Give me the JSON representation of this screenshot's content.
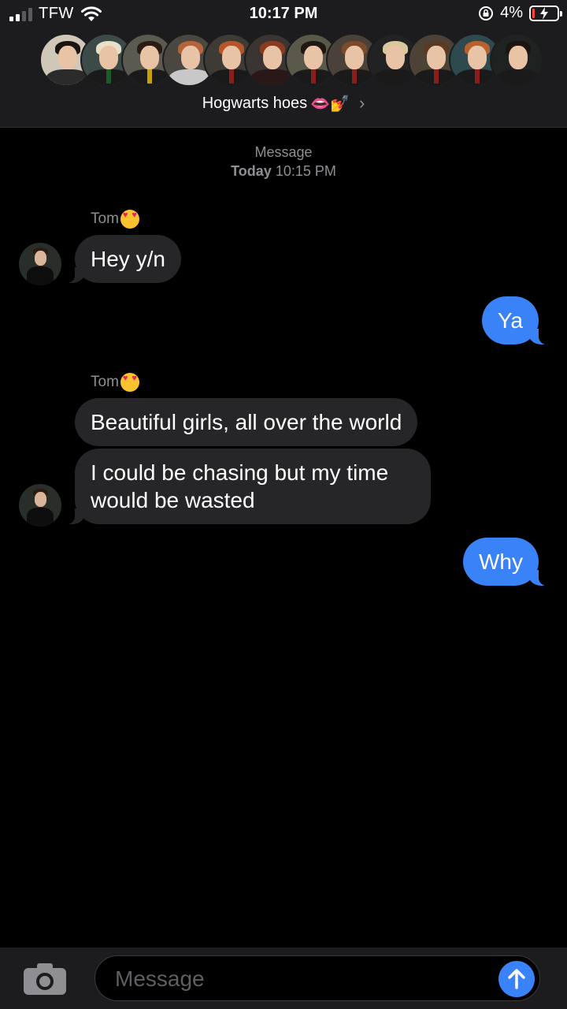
{
  "status_bar": {
    "carrier": "TFW",
    "time": "10:17 PM",
    "battery_percent": "4%"
  },
  "header": {
    "group_name": "Hogwarts hoes",
    "group_emojis": "👄💅",
    "participant_count": 12
  },
  "thread": {
    "timestamp_label": "Message",
    "timestamp_day": "Today",
    "timestamp_time": "10:15 PM",
    "sender_name": "Tom",
    "messages": [
      {
        "from": "Tom",
        "text": "Hey y/n"
      },
      {
        "from": "me",
        "text": "Ya"
      },
      {
        "from": "Tom",
        "text": "Beautiful girls, all over the world"
      },
      {
        "from": "Tom",
        "text": "I could be chasing but my time would be wasted"
      },
      {
        "from": "me",
        "text": "Why"
      }
    ]
  },
  "composer": {
    "placeholder": "Message"
  },
  "colors": {
    "outgoing_bubble": "#3a82f7",
    "incoming_bubble": "#262628",
    "header_bg": "#1c1c1e",
    "battery_low": "#ff453a"
  },
  "icons": [
    "signal-icon",
    "wifi-icon",
    "rotation-lock-icon",
    "battery-icon",
    "chevron-right-icon",
    "camera-icon",
    "send-arrow-icon"
  ]
}
